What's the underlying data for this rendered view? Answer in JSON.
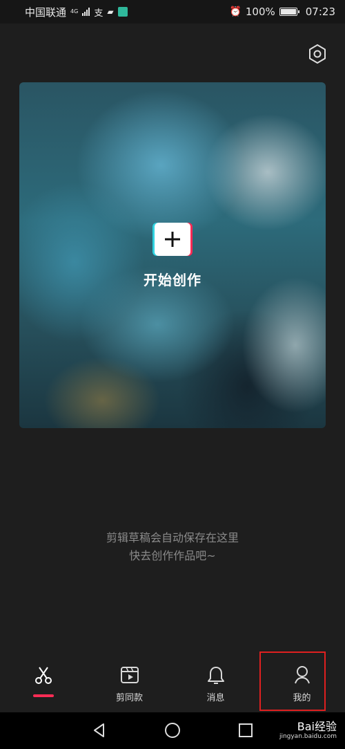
{
  "status_bar": {
    "carrier": "中国联通",
    "network": "4G",
    "battery": "100%",
    "time": "07:23"
  },
  "settings": {
    "icon": "hexagon-gear-icon"
  },
  "hero": {
    "action_label": "开始创作",
    "icon": "plus-icon"
  },
  "empty_hint": {
    "line1": "剪辑草稿会自动保存在这里",
    "line2": "快去创作作品吧~"
  },
  "tabs": [
    {
      "label": "",
      "icon": "scissors-icon",
      "active": true
    },
    {
      "label": "剪同款",
      "icon": "clapper-icon",
      "active": false
    },
    {
      "label": "消息",
      "icon": "bell-icon",
      "active": false
    },
    {
      "label": "我的",
      "icon": "user-icon",
      "active": false
    }
  ],
  "nav_bar": {
    "back": "back-triangle-icon",
    "home": "home-circle-icon",
    "recents": "recents-square-icon"
  },
  "watermark": {
    "brand": "Bai经验",
    "url": "jingyan.baidu.com"
  },
  "colors": {
    "background": "#1e1e1e",
    "accent": "#fe2c55",
    "cyan": "#2fd3e0",
    "highlight": "#e02020"
  }
}
